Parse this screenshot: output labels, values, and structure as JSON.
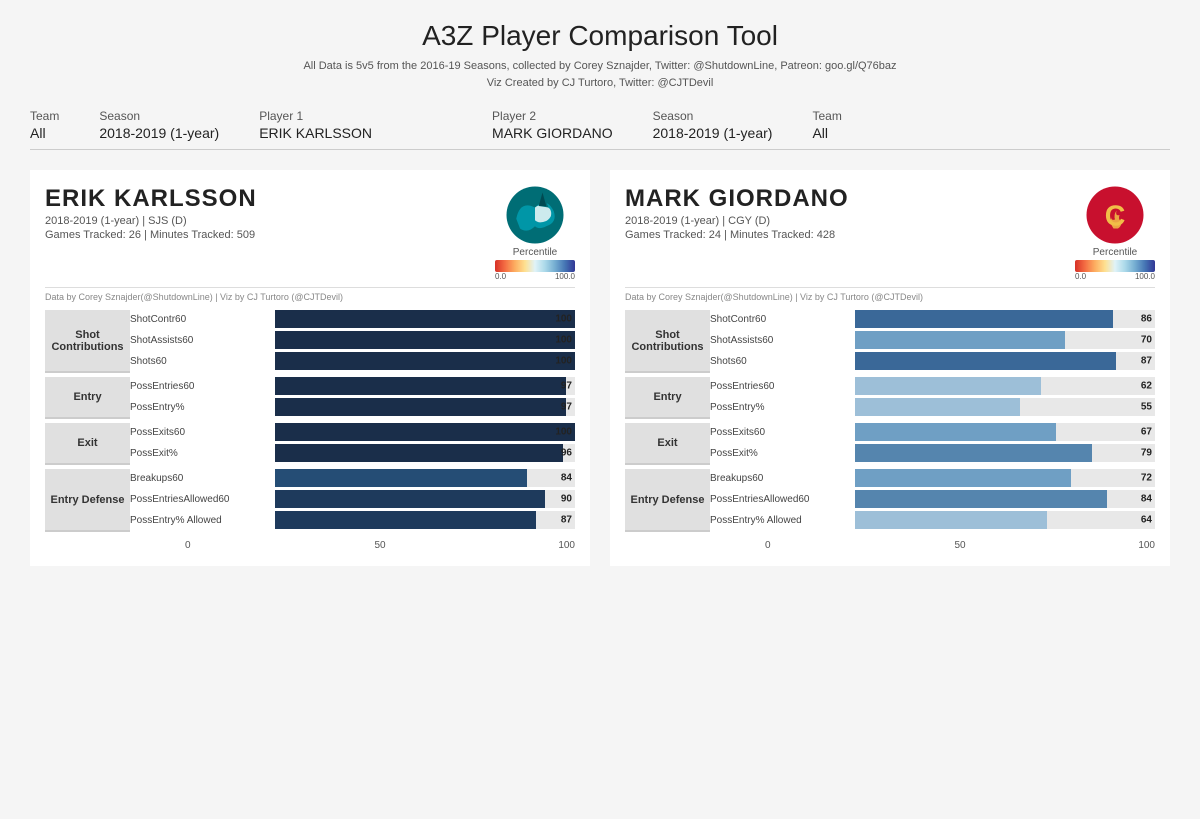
{
  "header": {
    "title": "A3Z Player Comparison Tool",
    "subtitle1": "All Data is 5v5 from the 2016-19 Seasons, collected by Corey Sznajder, Twitter: @ShutdownLine, Patreon: goo.gl/Q76baz",
    "subtitle2": "Viz Created by CJ Turtoro, Twitter: @CJTDevil"
  },
  "controls": {
    "p1_team_label": "Team",
    "p1_team_value": "All",
    "p1_season_label": "Season",
    "p1_season_value": "2018-2019 (1-year)",
    "p1_player_label": "Player 1",
    "p1_player_value": "ERIK KARLSSON",
    "p2_player_label": "Player 2",
    "p2_player_value": "MARK GIORDANO",
    "p2_season_label": "Season",
    "p2_season_value": "2018-2019 (1-year)",
    "p2_team_label": "Team",
    "p2_team_value": "All"
  },
  "player1": {
    "name": "ERIK KARLSSON",
    "season": "2018-2019 (1-year) | SJS (D)",
    "games": "Games Tracked: 26  |  Minutes Tracked: 509",
    "credit": "Data by Corey Sznajder(@ShutdownLine) | Viz by CJ Turtoro (@CJTDevil)",
    "percentile_min": "0.0",
    "percentile_max": "100.0",
    "percentile_label": "Percentile",
    "metrics": [
      {
        "category": "Shot\nContributions",
        "label": "ShotContr60",
        "value": 100,
        "color": "#1a3a5c"
      },
      {
        "category": "Shot\nContributions",
        "label": "ShotAssists60",
        "value": 100,
        "color": "#1a3a5c"
      },
      {
        "category": "Shot\nContributions",
        "label": "Shots60",
        "value": 100,
        "color": "#1a3a5c"
      },
      {
        "category": "Entry",
        "label": "PossEntries60",
        "value": 97,
        "color": "#1a3a5c"
      },
      {
        "category": "Entry",
        "label": "PossEntry%",
        "value": 97,
        "color": "#1a3a5c"
      },
      {
        "category": "Exit",
        "label": "PossExits60",
        "value": 100,
        "color": "#1a3a5c"
      },
      {
        "category": "Exit",
        "label": "PossExit%",
        "value": 96,
        "color": "#1a3a5c"
      },
      {
        "category": "Entry Defense",
        "label": "Breakups60",
        "value": 84,
        "color": "#1a3a5c"
      },
      {
        "category": "Entry Defense",
        "label": "PossEntriesAllowed60",
        "value": 90,
        "color": "#1a3a5c"
      },
      {
        "category": "Entry Defense",
        "label": "PossEntry% Allowed",
        "value": 87,
        "color": "#1a3a5c"
      }
    ],
    "categories": [
      {
        "name": "Shot\nContributions",
        "rows": 3
      },
      {
        "name": "Entry",
        "rows": 2
      },
      {
        "name": "Exit",
        "rows": 2
      },
      {
        "name": "Entry Defense",
        "rows": 3
      }
    ]
  },
  "player2": {
    "name": "MARK GIORDANO",
    "season": "2018-2019 (1-year) | CGY (D)",
    "games": "Games Tracked: 24  |  Minutes Tracked: 428",
    "credit": "Data by Corey Sznajder(@ShutdownLine) | Viz by CJ Turtoro (@CJTDevil)",
    "percentile_min": "0.0",
    "percentile_max": "100.0",
    "percentile_label": "Percentile",
    "metrics": [
      {
        "category": "Shot\nContributions",
        "label": "ShotContr60",
        "value": 86,
        "color": "#4b7eac"
      },
      {
        "category": "Shot\nContributions",
        "label": "ShotAssists60",
        "value": 70,
        "color": "#7badd4"
      },
      {
        "category": "Shot\nContributions",
        "label": "Shots60",
        "value": 87,
        "color": "#4b7eac"
      },
      {
        "category": "Entry",
        "label": "PossEntries60",
        "value": 62,
        "color": "#a8c8e0"
      },
      {
        "category": "Entry",
        "label": "PossEntry%",
        "value": 55,
        "color": "#c8dff0"
      },
      {
        "category": "Exit",
        "label": "PossExits60",
        "value": 67,
        "color": "#8fbcd8"
      },
      {
        "category": "Exit",
        "label": "PossExit%",
        "value": 79,
        "color": "#5a9bc0"
      },
      {
        "category": "Entry Defense",
        "label": "Breakups60",
        "value": 72,
        "color": "#7badd4"
      },
      {
        "category": "Entry Defense",
        "label": "PossEntriesAllowed60",
        "value": 84,
        "color": "#4b7eac"
      },
      {
        "category": "Entry Defense",
        "label": "PossEntry% Allowed",
        "value": 64,
        "color": "#9fc4dc"
      }
    ],
    "categories": [
      {
        "name": "Shot\nContributions",
        "rows": 3
      },
      {
        "name": "Entry",
        "rows": 2
      },
      {
        "name": "Exit",
        "rows": 2
      },
      {
        "name": "Entry Defense",
        "rows": 3
      }
    ]
  }
}
